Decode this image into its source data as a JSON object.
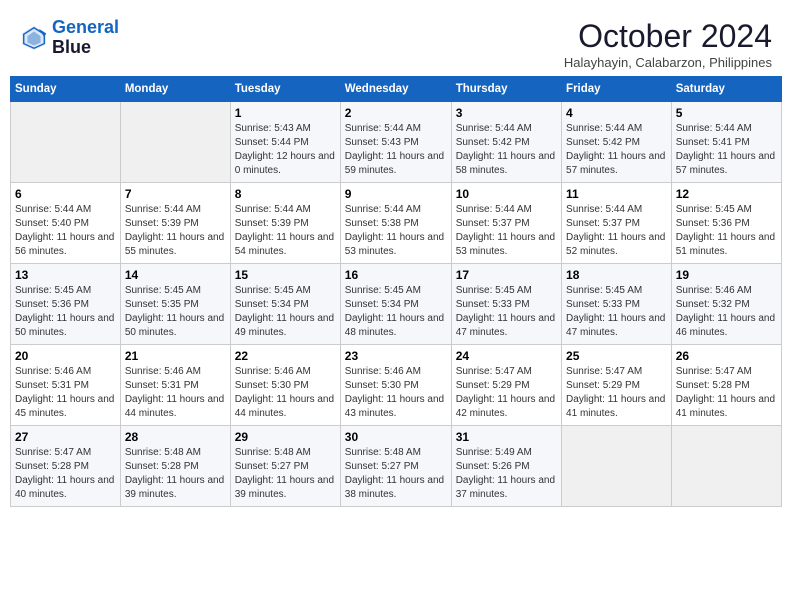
{
  "header": {
    "logo_line1": "General",
    "logo_line2": "Blue",
    "month_title": "October 2024",
    "location": "Halayhayin, Calabarzon, Philippines"
  },
  "days_of_week": [
    "Sunday",
    "Monday",
    "Tuesday",
    "Wednesday",
    "Thursday",
    "Friday",
    "Saturday"
  ],
  "weeks": [
    [
      {
        "day": "",
        "empty": true
      },
      {
        "day": "",
        "empty": true
      },
      {
        "day": "1",
        "sunrise": "Sunrise: 5:43 AM",
        "sunset": "Sunset: 5:44 PM",
        "daylight": "Daylight: 12 hours and 0 minutes."
      },
      {
        "day": "2",
        "sunrise": "Sunrise: 5:44 AM",
        "sunset": "Sunset: 5:43 PM",
        "daylight": "Daylight: 11 hours and 59 minutes."
      },
      {
        "day": "3",
        "sunrise": "Sunrise: 5:44 AM",
        "sunset": "Sunset: 5:42 PM",
        "daylight": "Daylight: 11 hours and 58 minutes."
      },
      {
        "day": "4",
        "sunrise": "Sunrise: 5:44 AM",
        "sunset": "Sunset: 5:42 PM",
        "daylight": "Daylight: 11 hours and 57 minutes."
      },
      {
        "day": "5",
        "sunrise": "Sunrise: 5:44 AM",
        "sunset": "Sunset: 5:41 PM",
        "daylight": "Daylight: 11 hours and 57 minutes."
      }
    ],
    [
      {
        "day": "6",
        "sunrise": "Sunrise: 5:44 AM",
        "sunset": "Sunset: 5:40 PM",
        "daylight": "Daylight: 11 hours and 56 minutes."
      },
      {
        "day": "7",
        "sunrise": "Sunrise: 5:44 AM",
        "sunset": "Sunset: 5:39 PM",
        "daylight": "Daylight: 11 hours and 55 minutes."
      },
      {
        "day": "8",
        "sunrise": "Sunrise: 5:44 AM",
        "sunset": "Sunset: 5:39 PM",
        "daylight": "Daylight: 11 hours and 54 minutes."
      },
      {
        "day": "9",
        "sunrise": "Sunrise: 5:44 AM",
        "sunset": "Sunset: 5:38 PM",
        "daylight": "Daylight: 11 hours and 53 minutes."
      },
      {
        "day": "10",
        "sunrise": "Sunrise: 5:44 AM",
        "sunset": "Sunset: 5:37 PM",
        "daylight": "Daylight: 11 hours and 53 minutes."
      },
      {
        "day": "11",
        "sunrise": "Sunrise: 5:44 AM",
        "sunset": "Sunset: 5:37 PM",
        "daylight": "Daylight: 11 hours and 52 minutes."
      },
      {
        "day": "12",
        "sunrise": "Sunrise: 5:45 AM",
        "sunset": "Sunset: 5:36 PM",
        "daylight": "Daylight: 11 hours and 51 minutes."
      }
    ],
    [
      {
        "day": "13",
        "sunrise": "Sunrise: 5:45 AM",
        "sunset": "Sunset: 5:36 PM",
        "daylight": "Daylight: 11 hours and 50 minutes."
      },
      {
        "day": "14",
        "sunrise": "Sunrise: 5:45 AM",
        "sunset": "Sunset: 5:35 PM",
        "daylight": "Daylight: 11 hours and 50 minutes."
      },
      {
        "day": "15",
        "sunrise": "Sunrise: 5:45 AM",
        "sunset": "Sunset: 5:34 PM",
        "daylight": "Daylight: 11 hours and 49 minutes."
      },
      {
        "day": "16",
        "sunrise": "Sunrise: 5:45 AM",
        "sunset": "Sunset: 5:34 PM",
        "daylight": "Daylight: 11 hours and 48 minutes."
      },
      {
        "day": "17",
        "sunrise": "Sunrise: 5:45 AM",
        "sunset": "Sunset: 5:33 PM",
        "daylight": "Daylight: 11 hours and 47 minutes."
      },
      {
        "day": "18",
        "sunrise": "Sunrise: 5:45 AM",
        "sunset": "Sunset: 5:33 PM",
        "daylight": "Daylight: 11 hours and 47 minutes."
      },
      {
        "day": "19",
        "sunrise": "Sunrise: 5:46 AM",
        "sunset": "Sunset: 5:32 PM",
        "daylight": "Daylight: 11 hours and 46 minutes."
      }
    ],
    [
      {
        "day": "20",
        "sunrise": "Sunrise: 5:46 AM",
        "sunset": "Sunset: 5:31 PM",
        "daylight": "Daylight: 11 hours and 45 minutes."
      },
      {
        "day": "21",
        "sunrise": "Sunrise: 5:46 AM",
        "sunset": "Sunset: 5:31 PM",
        "daylight": "Daylight: 11 hours and 44 minutes."
      },
      {
        "day": "22",
        "sunrise": "Sunrise: 5:46 AM",
        "sunset": "Sunset: 5:30 PM",
        "daylight": "Daylight: 11 hours and 44 minutes."
      },
      {
        "day": "23",
        "sunrise": "Sunrise: 5:46 AM",
        "sunset": "Sunset: 5:30 PM",
        "daylight": "Daylight: 11 hours and 43 minutes."
      },
      {
        "day": "24",
        "sunrise": "Sunrise: 5:47 AM",
        "sunset": "Sunset: 5:29 PM",
        "daylight": "Daylight: 11 hours and 42 minutes."
      },
      {
        "day": "25",
        "sunrise": "Sunrise: 5:47 AM",
        "sunset": "Sunset: 5:29 PM",
        "daylight": "Daylight: 11 hours and 41 minutes."
      },
      {
        "day": "26",
        "sunrise": "Sunrise: 5:47 AM",
        "sunset": "Sunset: 5:28 PM",
        "daylight": "Daylight: 11 hours and 41 minutes."
      }
    ],
    [
      {
        "day": "27",
        "sunrise": "Sunrise: 5:47 AM",
        "sunset": "Sunset: 5:28 PM",
        "daylight": "Daylight: 11 hours and 40 minutes."
      },
      {
        "day": "28",
        "sunrise": "Sunrise: 5:48 AM",
        "sunset": "Sunset: 5:28 PM",
        "daylight": "Daylight: 11 hours and 39 minutes."
      },
      {
        "day": "29",
        "sunrise": "Sunrise: 5:48 AM",
        "sunset": "Sunset: 5:27 PM",
        "daylight": "Daylight: 11 hours and 39 minutes."
      },
      {
        "day": "30",
        "sunrise": "Sunrise: 5:48 AM",
        "sunset": "Sunset: 5:27 PM",
        "daylight": "Daylight: 11 hours and 38 minutes."
      },
      {
        "day": "31",
        "sunrise": "Sunrise: 5:49 AM",
        "sunset": "Sunset: 5:26 PM",
        "daylight": "Daylight: 11 hours and 37 minutes."
      },
      {
        "day": "",
        "empty": true
      },
      {
        "day": "",
        "empty": true
      }
    ]
  ]
}
